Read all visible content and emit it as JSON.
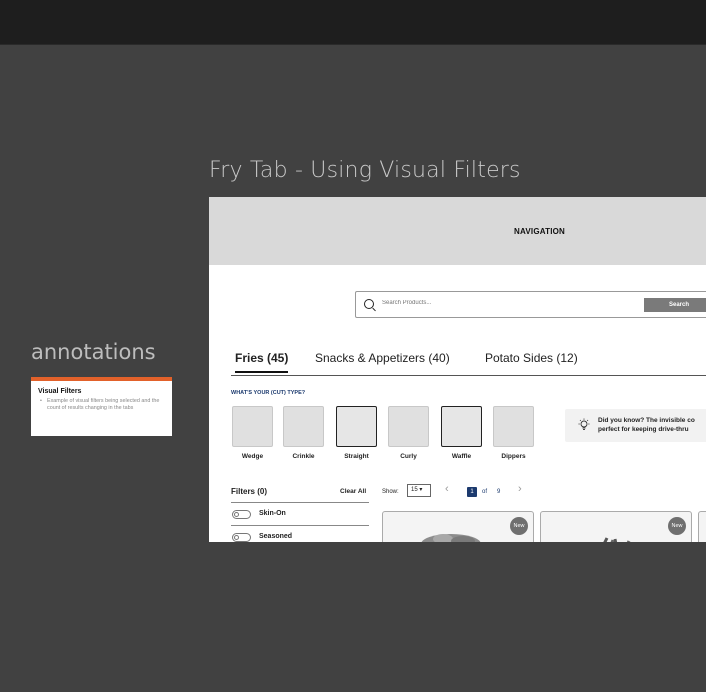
{
  "frame": {
    "title": "Fry Tab - Using Visual Filters"
  },
  "annotations": {
    "heading": "annotations",
    "note": {
      "title": "Visual Filters",
      "body": "Example of visual filters being selected and the count of results changing in the tabs"
    },
    "accent_color": "#e2612a"
  },
  "nav": {
    "label": "NAVIGATION"
  },
  "search": {
    "placeholder": "Search Products...",
    "button_label": "Search",
    "icon": "search-icon"
  },
  "tabs": [
    {
      "label": "Fries (45)",
      "active": true
    },
    {
      "label": "Snacks & Appetizers (40)",
      "active": false
    },
    {
      "label": "Potato Sides (12)",
      "active": false
    }
  ],
  "cut_type": {
    "question": "WHAT'S YOUR (CUT) TYPE?",
    "options": [
      {
        "label": "Wedge",
        "selected": false
      },
      {
        "label": "Crinkle",
        "selected": false
      },
      {
        "label": "Straight",
        "selected": true
      },
      {
        "label": "Curly",
        "selected": false
      },
      {
        "label": "Waffle",
        "selected": true
      },
      {
        "label": "Dippers",
        "selected": false
      }
    ]
  },
  "tip": {
    "icon": "lightbulb-icon",
    "line1": "Did you know? The invisible co",
    "line2": "perfect for keeping drive-thru"
  },
  "filters": {
    "heading": "Filters (0)",
    "clear_all": "Clear All",
    "items": [
      {
        "label": "Skin-On"
      },
      {
        "label": "Seasoned"
      }
    ]
  },
  "results": {
    "show_label": "Show:",
    "show_value": "15 ▾",
    "page_current": "1",
    "page_of": "of",
    "page_total": "9",
    "prev_icon": "chevron-left-icon",
    "next_icon": "chevron-right-icon"
  },
  "products": [
    {
      "badge": "New"
    },
    {
      "badge": "New"
    },
    {
      "badge": ""
    }
  ],
  "brand_color": "#1c3a6e"
}
